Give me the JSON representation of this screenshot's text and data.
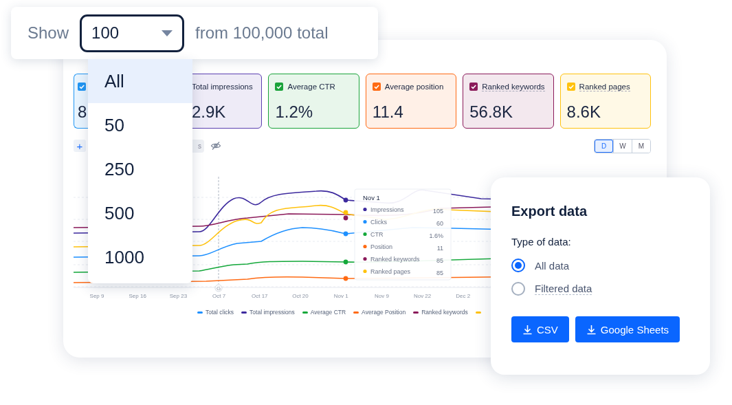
{
  "metrics": [
    {
      "kind": "clipped",
      "checked": true,
      "color": "#2196f3",
      "value": "8"
    },
    {
      "kind": "covered",
      "color": "#5b3fb0",
      "label": "Total impressions",
      "value": "2.9K"
    },
    {
      "kind": "checkbox",
      "checked": true,
      "color": "#1aa33a",
      "label": "Average CTR",
      "value": "1.2%"
    },
    {
      "kind": "checkbox",
      "checked": true,
      "color": "#ff6a13",
      "label": "Average position",
      "value": "11.4"
    },
    {
      "kind": "checkbox",
      "checked": true,
      "color": "#8b1a5a",
      "label": "Ranked keywords",
      "value": "56.8K"
    },
    {
      "kind": "checkbox",
      "checked": true,
      "color": "#ffc20e",
      "label": "Ranked pages",
      "value": "8.6K"
    }
  ],
  "toolbar": {
    "add": "+",
    "chip": "s"
  },
  "periods": [
    {
      "label": "D",
      "selected": true
    },
    {
      "label": "W",
      "selected": false
    },
    {
      "label": "M",
      "selected": false
    }
  ],
  "chart": {
    "x_labels": [
      "Sep 9",
      "Sep 16",
      "Sep 23",
      "Oct 7",
      "Oct 17",
      "Oct 20",
      "Nov 1",
      "Nov 9",
      "Nov 22",
      "Dec 2"
    ],
    "marker": "G",
    "tooltip": {
      "title": "Nov 1",
      "rows": [
        {
          "label": "Impressions",
          "value": "105",
          "color": "#3d2a9e"
        },
        {
          "label": "Clicks",
          "value": "60",
          "color": "#1e90ff"
        },
        {
          "label": "CTR",
          "value": "1.6%",
          "color": "#14a83a"
        },
        {
          "label": "Position",
          "value": "11",
          "color": "#ff6a13"
        },
        {
          "label": "Ranked keywords",
          "value": "85",
          "color": "#8b1a5a"
        },
        {
          "label": "Ranked pages",
          "value": "85",
          "color": "#ffc20e"
        }
      ]
    },
    "legend": [
      {
        "label": "Total clicks",
        "color": "#1e90ff"
      },
      {
        "label": "Total impressions",
        "color": "#3d2a9e"
      },
      {
        "label": "Average CTR",
        "color": "#14a83a"
      },
      {
        "label": "Average Position",
        "color": "#ff6a13"
      },
      {
        "label": "Ranked keywords",
        "color": "#8b1a5a"
      },
      {
        "color": "#ffc20e"
      }
    ]
  },
  "show_bar": {
    "label": "Show",
    "value": "100",
    "suffix": "from 100,000 total"
  },
  "dropdown": [
    {
      "label": "All",
      "selected": true
    },
    {
      "label": "50",
      "selected": false
    },
    {
      "label": "250",
      "selected": false
    },
    {
      "label": "500",
      "selected": false
    },
    {
      "label": "1000",
      "selected": false
    }
  ],
  "export": {
    "title": "Export data",
    "subtitle": "Type of data:",
    "options": [
      {
        "label": "All data",
        "selected": true
      },
      {
        "label": "Filtered data",
        "selected": false
      }
    ],
    "buttons": [
      "CSV",
      "Google Sheets"
    ]
  }
}
